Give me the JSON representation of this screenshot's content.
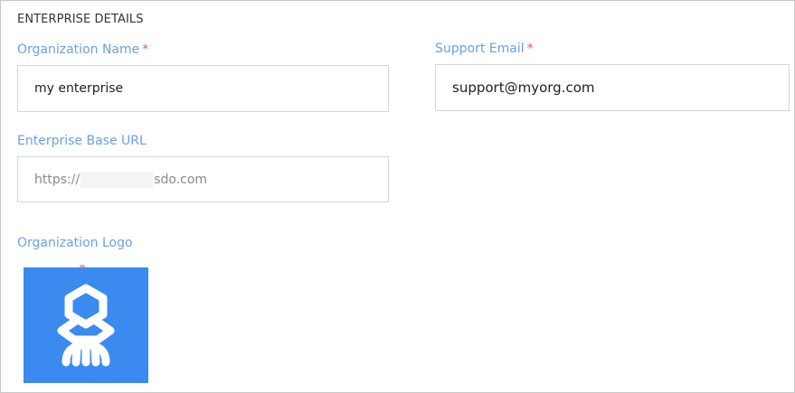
{
  "section": {
    "title": "ENTERPRISE DETAILS"
  },
  "org_name": {
    "label": "Organization Name",
    "required_mark": "*",
    "value": "my enterprise"
  },
  "support_email": {
    "label": "Support Email",
    "required_mark": "*",
    "value": "support@myorg.com"
  },
  "base_url": {
    "label": "Enterprise Base URL",
    "prefix": "https://",
    "suffix": "sdo.com"
  },
  "logo": {
    "label": "Organization Logo",
    "icon": "hub-network-icon",
    "background": "#3a8af0"
  },
  "colors": {
    "label": "#6aa0e8",
    "required": "#e05a5a",
    "border": "#d6d6d6"
  }
}
